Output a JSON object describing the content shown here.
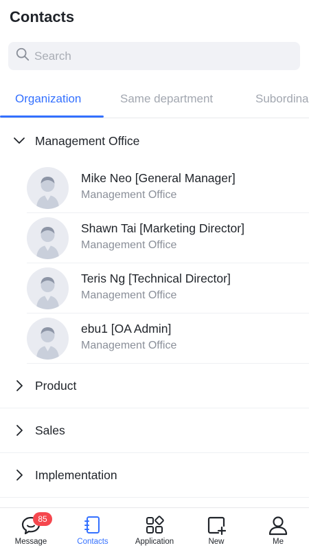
{
  "header": {
    "title": "Contacts"
  },
  "search": {
    "placeholder": "Search"
  },
  "tabs": [
    {
      "label": "Organization",
      "active": true
    },
    {
      "label": "Same department",
      "active": false
    },
    {
      "label": "Subordina",
      "active": false
    }
  ],
  "groups": {
    "expanded": {
      "label": "Management Office"
    },
    "collapsed": [
      {
        "label": "Product"
      },
      {
        "label": "Sales"
      },
      {
        "label": "Implementation"
      }
    ]
  },
  "contacts": [
    {
      "name": "Mike Neo [General Manager]",
      "department": "Management Office"
    },
    {
      "name": "Shawn Tai [Marketing Director]",
      "department": "Management Office"
    },
    {
      "name": "Teris Ng [Technical Director]",
      "department": "Management Office"
    },
    {
      "name": "ebu1 [OA Admin]",
      "department": "Management Office"
    }
  ],
  "tabbar": {
    "items": [
      {
        "label": "Message",
        "icon": "message-icon",
        "badge": "85"
      },
      {
        "label": "Contacts",
        "icon": "contacts-icon",
        "active": true
      },
      {
        "label": "Application",
        "icon": "application-icon"
      },
      {
        "label": "New",
        "icon": "new-icon"
      },
      {
        "label": "Me",
        "icon": "me-icon"
      }
    ]
  },
  "colors": {
    "accent": "#3370ff",
    "badge": "#f5474e",
    "search_bg": "#f1f2f6"
  }
}
